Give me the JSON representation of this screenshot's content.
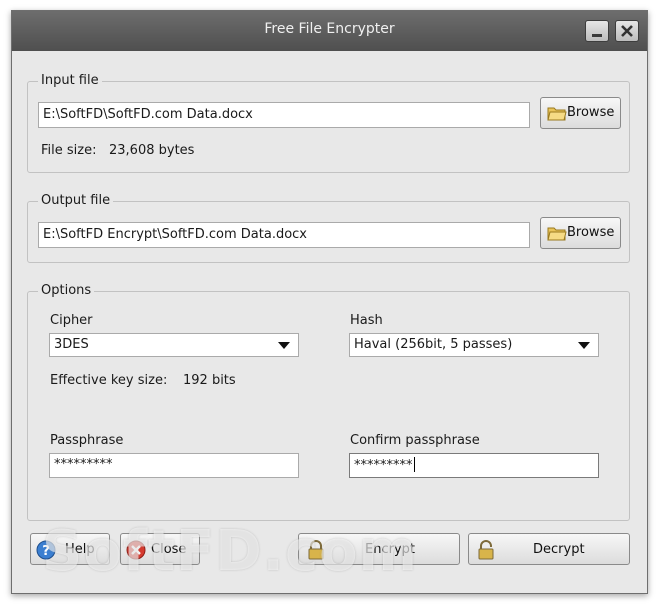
{
  "window": {
    "title": "Free File Encrypter"
  },
  "input_file": {
    "group_label": "Input file",
    "path": "E:\\SoftFD\\SoftFD.com Data.docx",
    "browse_label": "Browse",
    "size_label": "File size:",
    "size_value": "23,608 bytes"
  },
  "output_file": {
    "group_label": "Output file",
    "path": "E:\\SoftFD Encrypt\\SoftFD.com Data.docx",
    "browse_label": "Browse"
  },
  "options": {
    "group_label": "Options",
    "cipher_label": "Cipher",
    "cipher_value": "3DES",
    "hash_label": "Hash",
    "hash_value": "Haval (256bit, 5 passes)",
    "key_size_label": "Effective key size:",
    "key_size_value": "192 bits",
    "passphrase_label": "Passphrase",
    "passphrase_value": "*********",
    "confirm_label": "Confirm passphrase",
    "confirm_value": "*********"
  },
  "buttons": {
    "help": "Help",
    "close": "Close",
    "encrypt": "Encrypt",
    "decrypt": "Decrypt"
  },
  "watermark": "SoftFD.com",
  "icons": {
    "folder": "folder-icon",
    "help": "help-icon",
    "close": "close-icon",
    "lock": "lock-icon",
    "unlock": "unlock-icon"
  }
}
